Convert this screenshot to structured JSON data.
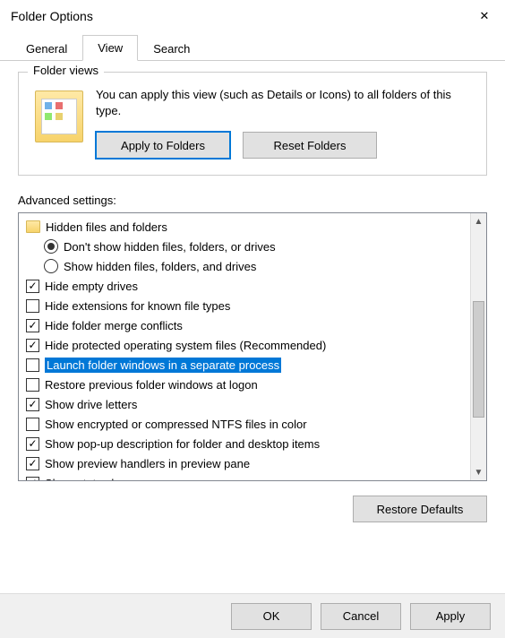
{
  "title": "Folder Options",
  "tabs": {
    "general": "General",
    "view": "View",
    "search": "Search",
    "active": "view"
  },
  "folder_views": {
    "title": "Folder views",
    "text": "You can apply this view (such as Details or Icons) to all folders of this type.",
    "apply_btn": "Apply to Folders",
    "reset_btn": "Reset Folders"
  },
  "advanced_label": "Advanced settings:",
  "items": [
    {
      "type": "folder",
      "label": "Hidden files and folders"
    },
    {
      "type": "radio",
      "checked": true,
      "indent": true,
      "label": "Don't show hidden files, folders, or drives"
    },
    {
      "type": "radio",
      "checked": false,
      "indent": true,
      "label": "Show hidden files, folders, and drives"
    },
    {
      "type": "check",
      "checked": true,
      "label": "Hide empty drives"
    },
    {
      "type": "check",
      "checked": false,
      "label": "Hide extensions for known file types"
    },
    {
      "type": "check",
      "checked": true,
      "label": "Hide folder merge conflicts"
    },
    {
      "type": "check",
      "checked": true,
      "label": "Hide protected operating system files (Recommended)"
    },
    {
      "type": "check",
      "checked": false,
      "selected": true,
      "label": "Launch folder windows in a separate process"
    },
    {
      "type": "check",
      "checked": false,
      "label": "Restore previous folder windows at logon"
    },
    {
      "type": "check",
      "checked": true,
      "label": "Show drive letters"
    },
    {
      "type": "check",
      "checked": false,
      "label": "Show encrypted or compressed NTFS files in color"
    },
    {
      "type": "check",
      "checked": true,
      "label": "Show pop-up description for folder and desktop items"
    },
    {
      "type": "check",
      "checked": true,
      "label": "Show preview handlers in preview pane"
    },
    {
      "type": "check",
      "checked": true,
      "label": "Show status bar",
      "cut": true
    }
  ],
  "restore_defaults": "Restore Defaults",
  "footer": {
    "ok": "OK",
    "cancel": "Cancel",
    "apply": "Apply"
  }
}
